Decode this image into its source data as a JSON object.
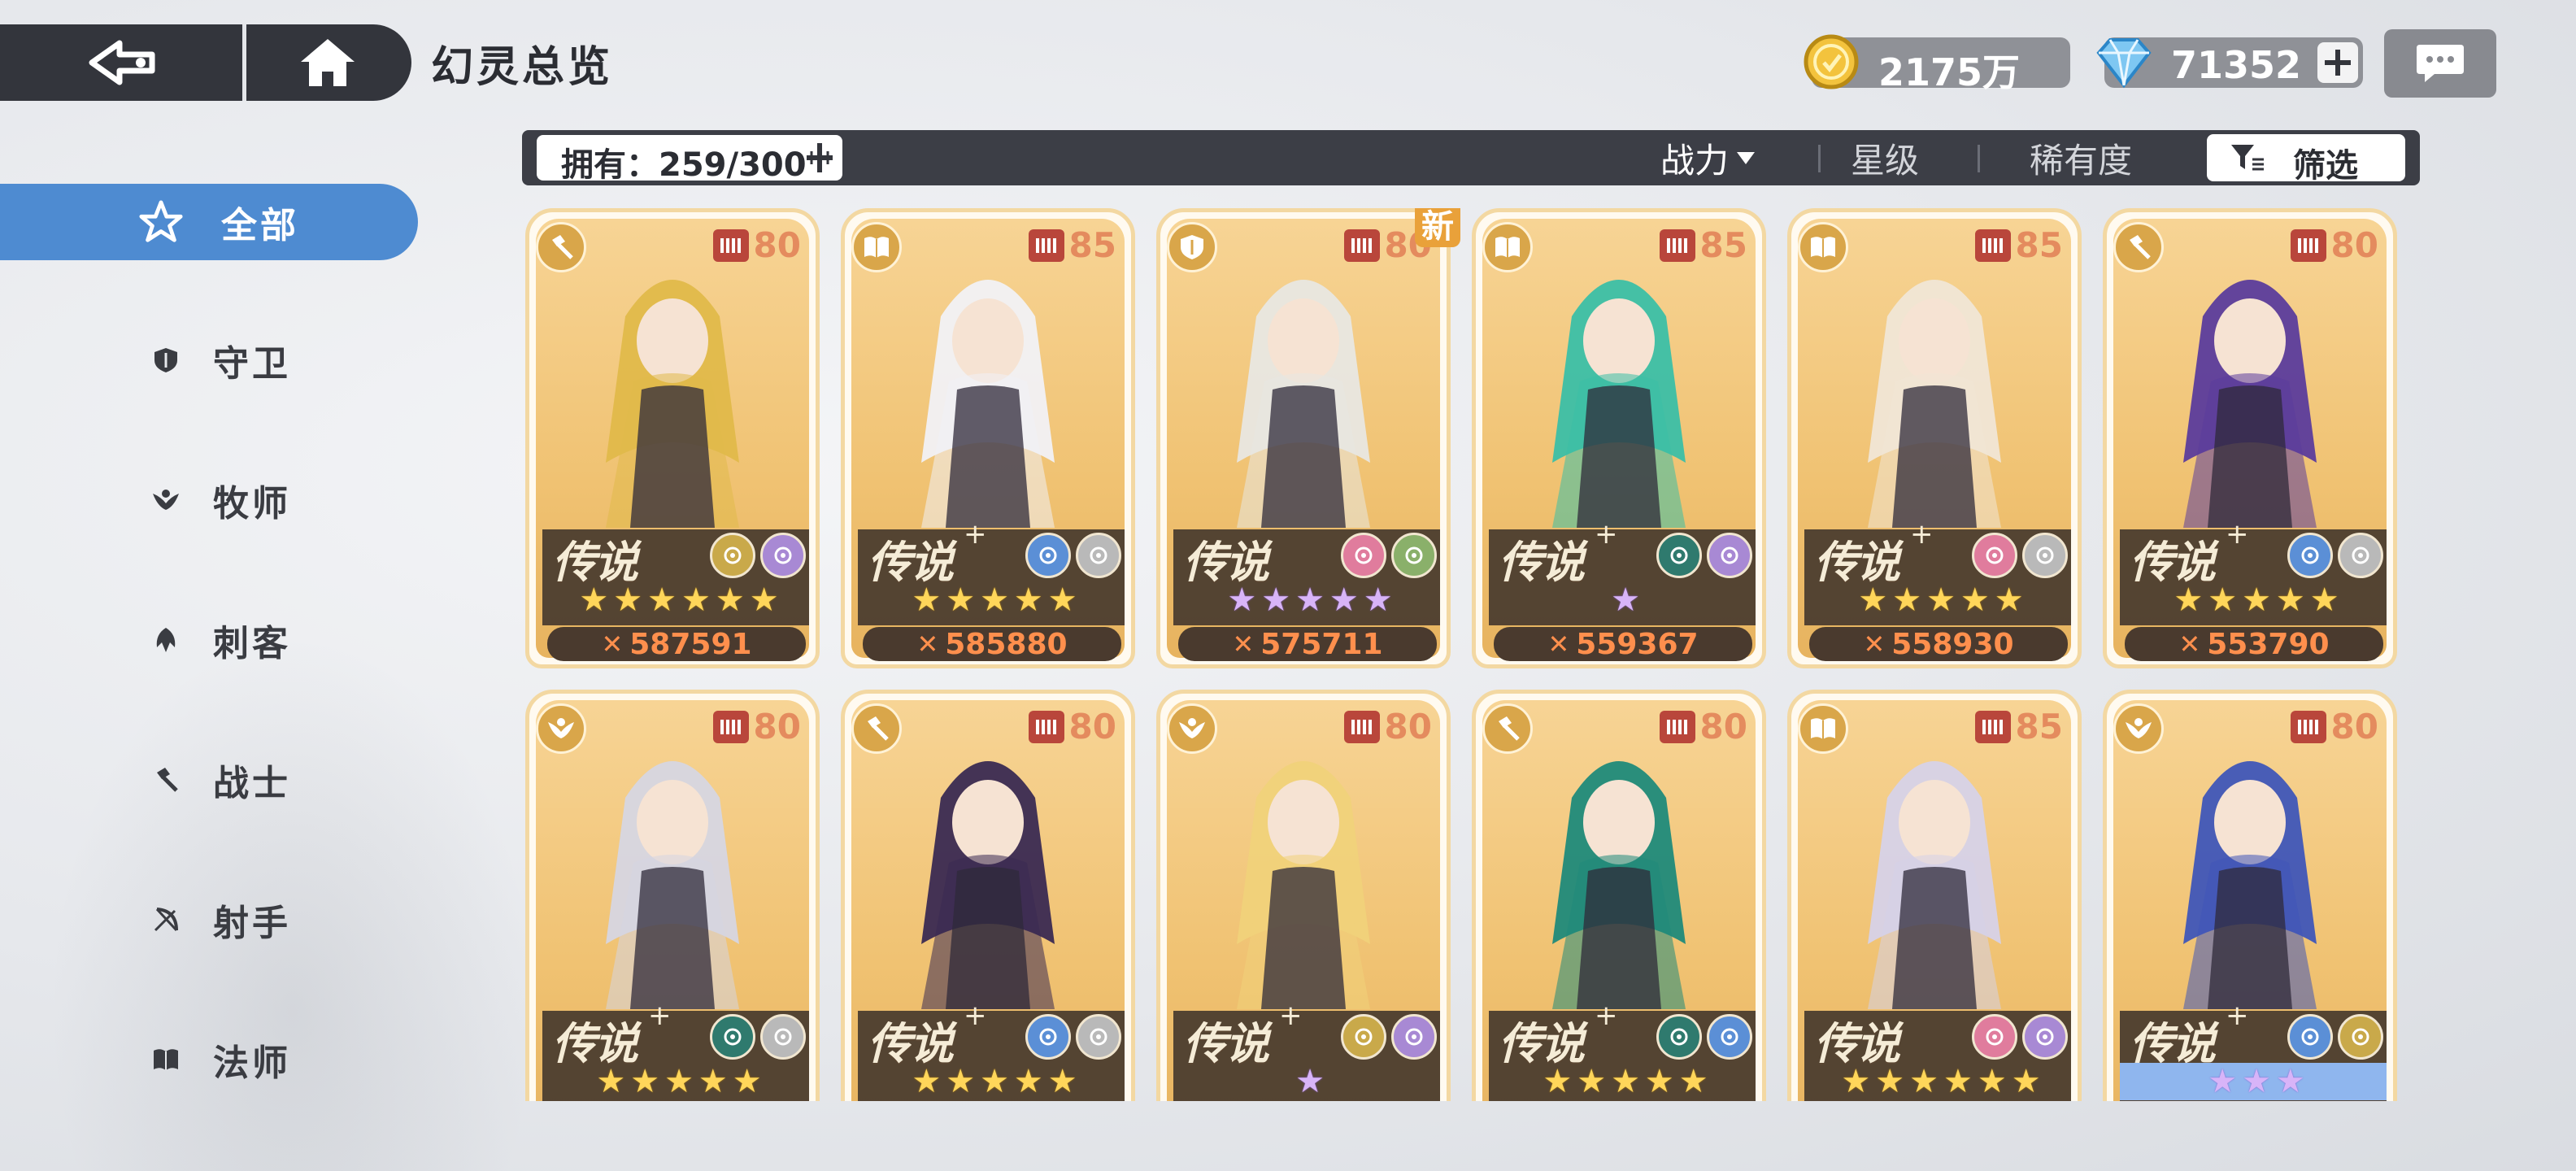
{
  "header": {
    "title": "幻灵总览"
  },
  "resources": {
    "gold": {
      "value": "2175万",
      "icon": "gold-coin-icon"
    },
    "gems": {
      "value": "71352",
      "icon": "blue-gem-icon"
    }
  },
  "sidebar": {
    "items": [
      {
        "label": "全部",
        "icon": "all-star-icon",
        "active": true
      },
      {
        "label": "守卫",
        "icon": "shield-icon"
      },
      {
        "label": "牧师",
        "icon": "wings-icon"
      },
      {
        "label": "刺客",
        "icon": "assassin-icon"
      },
      {
        "label": "战士",
        "icon": "hammer-icon"
      },
      {
        "label": "射手",
        "icon": "bow-icon"
      },
      {
        "label": "法师",
        "icon": "book-icon"
      }
    ]
  },
  "filter_bar": {
    "owned": "拥有：259/300",
    "sort_power": "战力",
    "sort_star": "星级",
    "sort_rarity": "稀有度",
    "filter": "筛选"
  },
  "cards": [
    {
      "role": "hammer-icon",
      "level": "80",
      "rarity": "传说",
      "plus": "",
      "elements": [
        "#c9a94a",
        "#a889d4"
      ],
      "stars": 6,
      "star_color": "gold",
      "power": "587591",
      "new": "",
      "hair": "#e0b94a"
    },
    {
      "role": "book-icon",
      "level": "85",
      "rarity": "传说",
      "plus": "+",
      "elements": [
        "#5b8fd6",
        "#b9b9b9"
      ],
      "stars": 5,
      "star_color": "gold",
      "power": "585880",
      "new": "",
      "hair": "#f1f1f6"
    },
    {
      "role": "shield-icon",
      "level": "80",
      "rarity": "传说",
      "plus": "",
      "elements": [
        "#e07c9d",
        "#8ab06a"
      ],
      "stars": 5,
      "star_color": "purple",
      "power": "575711",
      "new": "新",
      "hair": "#e8e7e2"
    },
    {
      "role": "book-icon",
      "level": "85",
      "rarity": "传说",
      "plus": "+",
      "elements": [
        "#2f7a6e",
        "#a889d4"
      ],
      "stars": 1,
      "star_color": "purple",
      "power": "559367",
      "new": "",
      "hair": "#3bbfa6"
    },
    {
      "role": "book-icon",
      "level": "85",
      "rarity": "传说",
      "plus": "+",
      "elements": [
        "#e07c9d",
        "#b9b9b9"
      ],
      "stars": 5,
      "star_color": "gold",
      "power": "558930",
      "new": "",
      "hair": "#f0e6d6"
    },
    {
      "role": "hammer-icon",
      "level": "80",
      "rarity": "传说",
      "plus": "+",
      "elements": [
        "#5b8fd6",
        "#b9b9b9"
      ],
      "stars": 5,
      "star_color": "gold",
      "power": "553790",
      "new": "",
      "hair": "#5b3c9c"
    },
    {
      "role": "wings-icon",
      "level": "80",
      "rarity": "传说",
      "plus": "+",
      "elements": [
        "#2f7a6e",
        "#b9b9b9"
      ],
      "stars": 5,
      "star_color": "gold",
      "power": "",
      "new": "",
      "hair": "#d6d6e2"
    },
    {
      "role": "hammer-icon",
      "level": "80",
      "rarity": "传说",
      "plus": "+",
      "elements": [
        "#5b8fd6",
        "#b9b9b9"
      ],
      "stars": 5,
      "star_color": "gold",
      "power": "",
      "new": "",
      "hair": "#3a2a52"
    },
    {
      "role": "wings-icon",
      "level": "80",
      "rarity": "传说",
      "plus": "+",
      "elements": [
        "#c9a94a",
        "#a889d4"
      ],
      "stars": 1,
      "star_color": "purple",
      "power": "",
      "new": "",
      "hair": "#f0d27a"
    },
    {
      "role": "hammer-icon",
      "level": "80",
      "rarity": "传说",
      "plus": "+",
      "elements": [
        "#2f7a6e",
        "#5b8fd6"
      ],
      "stars": 5,
      "star_color": "gold",
      "power": "",
      "new": "",
      "hair": "#1f8a7a"
    },
    {
      "role": "book-icon",
      "level": "85",
      "rarity": "传说",
      "plus": "",
      "elements": [
        "#e07c9d",
        "#a889d4"
      ],
      "stars": 6,
      "star_color": "gold",
      "power": "",
      "new": "",
      "hair": "#d6d2e8"
    },
    {
      "role": "wings-icon",
      "level": "80",
      "rarity": "传说",
      "plus": "+",
      "elements": [
        "#5b8fd6",
        "#c9a94a"
      ],
      "stars": 3,
      "star_color": "purple",
      "power": "",
      "new": "",
      "hair": "#3f56b8",
      "star_bg": "blue"
    }
  ]
}
